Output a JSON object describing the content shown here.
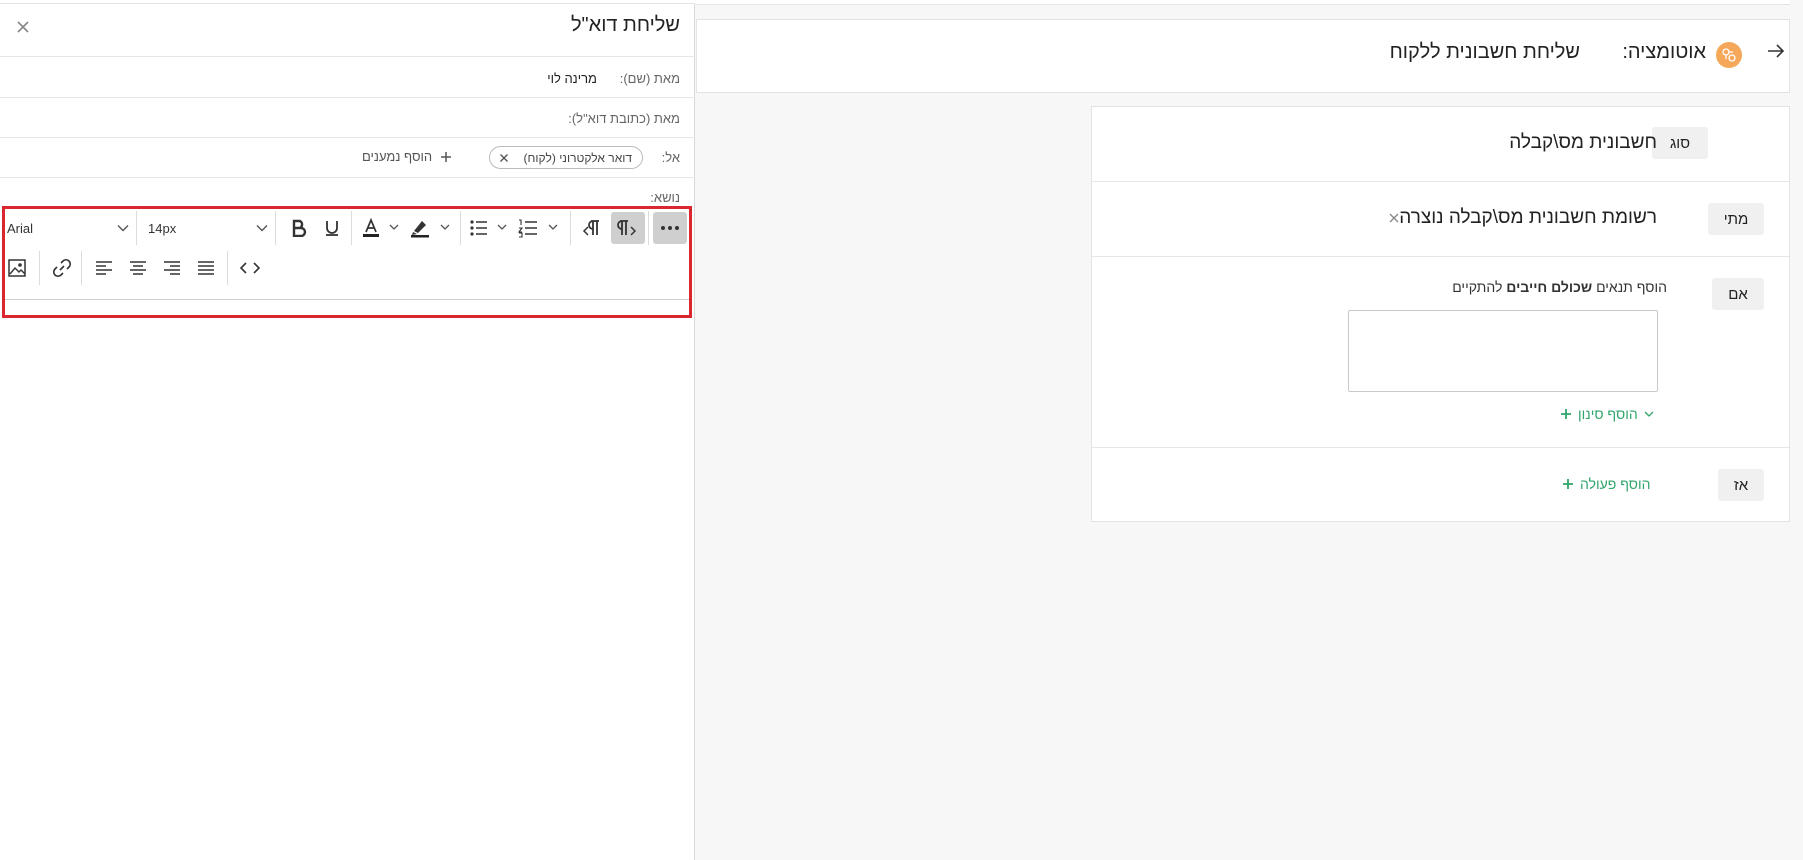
{
  "email_panel": {
    "title": "שליחת דוא\"ל",
    "from_name_label": "מאת (שם):",
    "from_name_value": "מרינה לוי",
    "from_email_label": "מאת (כתובת דוא\"ל):",
    "to_label": "אל:",
    "to_chip": "דואר אלקטרוני (לקוח)",
    "add_recipients": "הוסף נמענים",
    "subject_label": "נושא:"
  },
  "toolbar": {
    "font_family": "Arial",
    "font_size": "14px",
    "icons": [
      "more-icon",
      "rtl-icon",
      "ltr-icon",
      "numbered-list-icon",
      "bullet-list-icon",
      "highlight-icon",
      "font-color-icon",
      "underline-icon",
      "bold-icon",
      "code-icon",
      "justify-icon",
      "align-right-icon",
      "align-center-icon",
      "align-left-icon",
      "link-icon",
      "image-icon"
    ]
  },
  "automation": {
    "label": "אוטומציה:",
    "name": "שליחת חשבונית ללקוח",
    "type_tag": "סוג",
    "type_value": "חשבונית מס\\קבלה",
    "when_tag": "מתי",
    "when_value": "רשומת חשבונית מס\\קבלה נוצרה",
    "if_tag": "אם",
    "condition_hint_prefix": "הוסף תנאים",
    "condition_hint_bold": "שכולם חייבים",
    "condition_hint_suffix": "להתקיים",
    "add_filter": "הוסף סינון",
    "then_tag": "אז",
    "add_action": "הוסף פעולה"
  },
  "colors": {
    "accent_green": "#2fa56b",
    "highlight_red": "#d9262f",
    "automation_icon": "#f5a85a"
  }
}
